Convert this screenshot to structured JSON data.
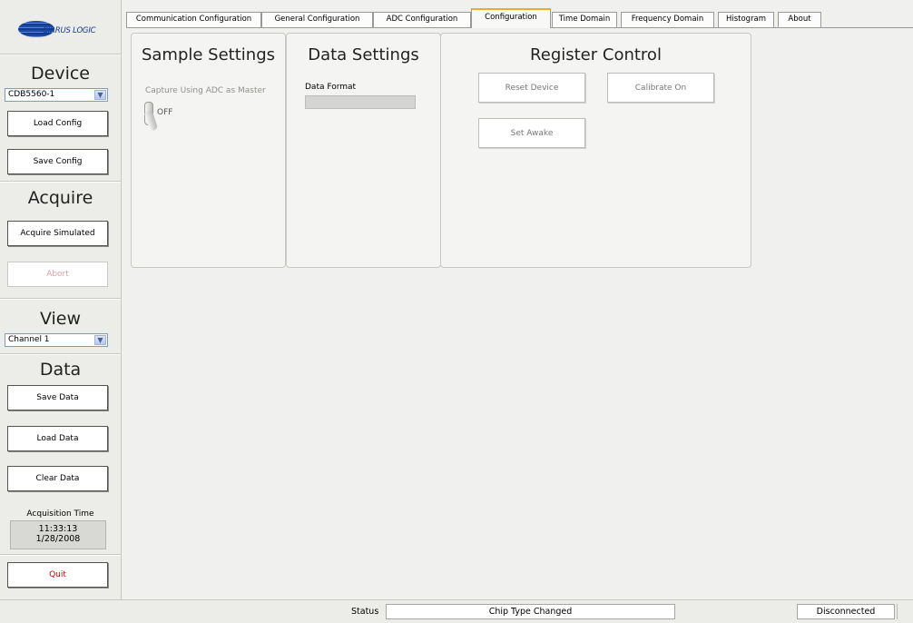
{
  "sidebar": {
    "logo_text": "CIRRUS LOGIC",
    "device_heading": "Device",
    "device_select_value": "CDB5560-1",
    "load_config": "Load Config",
    "save_config": "Save Config",
    "acquire_heading": "Acquire",
    "acquire_simulated": "Acquire Simulated",
    "abort": "Abort",
    "view_heading": "View",
    "view_select_value": "Channel 1",
    "data_heading": "Data",
    "save_data": "Save Data",
    "load_data": "Load Data",
    "clear_data": "Clear Data",
    "acquisition_time_label": "Acquisition Time",
    "acquisition_time": "11:33:13",
    "acquisition_date": "1/28/2008",
    "quit": "Quit"
  },
  "tabs": [
    {
      "label": "Communication Configuration"
    },
    {
      "label": "General Configuration"
    },
    {
      "label": "ADC Configuration"
    },
    {
      "label": "Configuration"
    },
    {
      "label": "Time Domain"
    },
    {
      "label": "Frequency Domain"
    },
    {
      "label": "Histogram"
    },
    {
      "label": "About"
    }
  ],
  "active_tab": "Configuration",
  "sample_settings": {
    "title": "Sample Settings",
    "capture_label": "Capture Using ADC as Master",
    "toggle_state": "OFF"
  },
  "data_settings": {
    "title": "Data Settings",
    "data_format_label": "Data Format",
    "data_format_value": ""
  },
  "register_control": {
    "title": "Register Control",
    "reset_device": "Reset Device",
    "calibrate_on": "Calibrate On",
    "set_awake": "Set Awake"
  },
  "status_bar": {
    "label": "Status",
    "message": "Chip Type Changed",
    "connection": "Disconnected"
  },
  "colors": {
    "active_tab_accent": "#f3a830",
    "quit_text": "#cc0000",
    "logo_blue": "#123c96"
  }
}
